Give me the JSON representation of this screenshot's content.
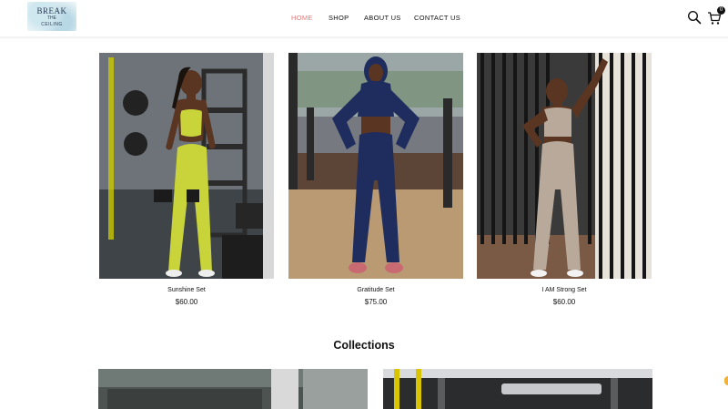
{
  "header": {
    "logo": {
      "line1": "BREAK",
      "line2": "THE",
      "line3": "CEILING"
    },
    "nav": [
      {
        "label": "HOME",
        "active": true
      },
      {
        "label": "SHOP",
        "active": false
      },
      {
        "label": "ABOUT US",
        "active": false
      },
      {
        "label": "CONTACT US",
        "active": false
      }
    ],
    "cart_count": "0",
    "icons": [
      "search-icon",
      "cart-icon"
    ]
  },
  "products": [
    {
      "name": "Sunshine Set",
      "price": "$60.00",
      "outfit_color": "#c9d43a"
    },
    {
      "name": "Gratitude Set",
      "price": "$75.00",
      "outfit_color": "#1e2c5e"
    },
    {
      "name": "I AM Strong Set",
      "price": "$60.00",
      "outfit_color": "#b8a99a"
    }
  ],
  "collections": {
    "title": "Collections"
  },
  "colors": {
    "accent": "#e07a7a",
    "text": "#111111"
  }
}
